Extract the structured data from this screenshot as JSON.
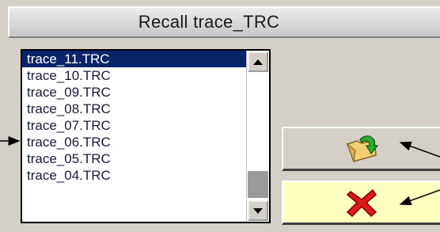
{
  "dialog": {
    "title": "Recall trace_TRC"
  },
  "file_list": {
    "items": [
      {
        "label": "trace_11.TRC",
        "selected": true
      },
      {
        "label": "trace_10.TRC",
        "selected": false
      },
      {
        "label": "trace_09.TRC",
        "selected": false
      },
      {
        "label": "trace_08.TRC",
        "selected": false
      },
      {
        "label": "trace_07.TRC",
        "selected": false
      },
      {
        "label": "trace_06.TRC",
        "selected": false
      },
      {
        "label": "trace_05.TRC",
        "selected": false
      },
      {
        "label": "trace_04.TRC",
        "selected": false
      }
    ]
  },
  "buttons": {
    "recall_icon": "folder-recall-icon",
    "cancel_icon": "red-x-cancel-icon"
  },
  "colors": {
    "selection": "#0a246a",
    "cancel_background": "#ffffc0",
    "dialog_background": "#d4d0c8"
  }
}
